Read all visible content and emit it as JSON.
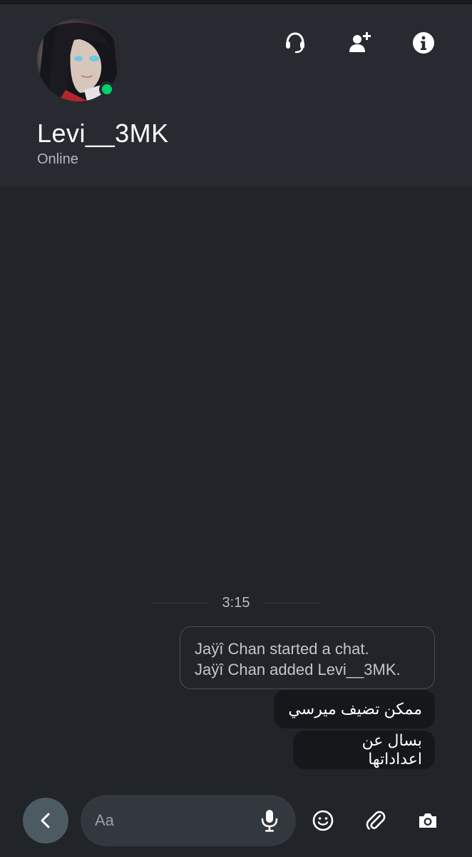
{
  "header": {
    "contact_name": "Levi__3MK",
    "status": "Online"
  },
  "icons": {
    "call": "headset-icon",
    "add_person": "add-person-icon",
    "info": "info-icon",
    "back": "chevron-left-icon",
    "mic": "mic-icon",
    "emoji": "emoji-icon",
    "attach": "paperclip-icon",
    "camera": "camera-icon"
  },
  "chat": {
    "time_divider": "3:15",
    "system_lines": [
      "Jaÿî Chan started a chat.",
      "Jaÿî Chan added Levi__3MK."
    ],
    "messages": [
      "ممكن تضيف ميرسي",
      "بسال عن اعداداتها"
    ]
  },
  "composer": {
    "placeholder": "Aa",
    "value": ""
  },
  "colors": {
    "background": "#212429",
    "header": "#272a30",
    "online": "#00d26a",
    "bubble": "#15171a",
    "back_button": "#4c5b61"
  }
}
